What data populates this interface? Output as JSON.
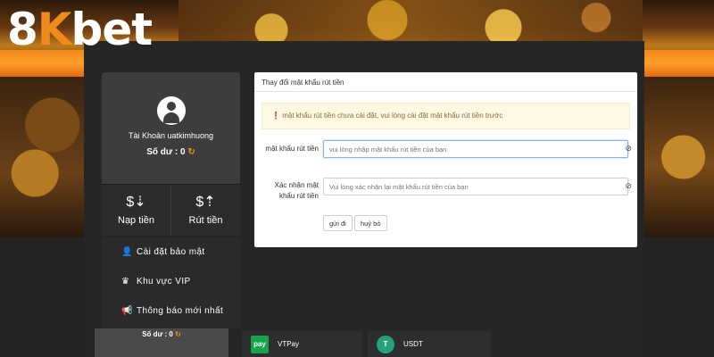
{
  "brand": {
    "logo_main": "8",
    "logo_k": "K",
    "logo_tail": "bet"
  },
  "user": {
    "account_label": "Tài Khoản uatkimhuong",
    "balance_label": "Số dư :",
    "balance_value": "0",
    "refresh_icon": "refresh-icon"
  },
  "actions": [
    {
      "label": "Nạp tiền",
      "icon": "deposit-icon"
    },
    {
      "label": "Rút tiền",
      "icon": "withdraw-icon"
    }
  ],
  "menu": [
    {
      "label": "Cài đặt bảo mật",
      "icon": "user-security-icon"
    },
    {
      "label": "Khu vực VIP",
      "icon": "vip-crown-icon"
    },
    {
      "label": "Thông báo mới nhất",
      "icon": "megaphone-icon"
    }
  ],
  "card": {
    "title": "Thay đổi mật khẩu rút tiền",
    "alert": "mật khẩu rút tiền chưa cài đặt, vui lòng cài đặt mật khẩu rút tiền trước",
    "fields": [
      {
        "label": "mật khẩu rút tiền",
        "placeholder": "vui lòng nhập mật khẩu rút tiền của bạn"
      },
      {
        "label": "Xác nhận mật khẩu rút tiền",
        "placeholder": "Vui lòng xác nhận lại mật khẩu rút tiền của bạn"
      }
    ],
    "submit": "gửi đi",
    "cancel": "huỷ bỏ"
  },
  "bottom": {
    "balance_label": "Số dư :",
    "balance_value": "0",
    "payments": [
      {
        "name": "VTPay",
        "logo_text": "pay"
      },
      {
        "name": "USDT",
        "logo_text": "T"
      }
    ]
  },
  "colors": {
    "accent": "#f08a1c",
    "panel": "#3d3d3d",
    "alert_bg": "#fcf8e3",
    "alert_text": "#8a6d3b"
  }
}
